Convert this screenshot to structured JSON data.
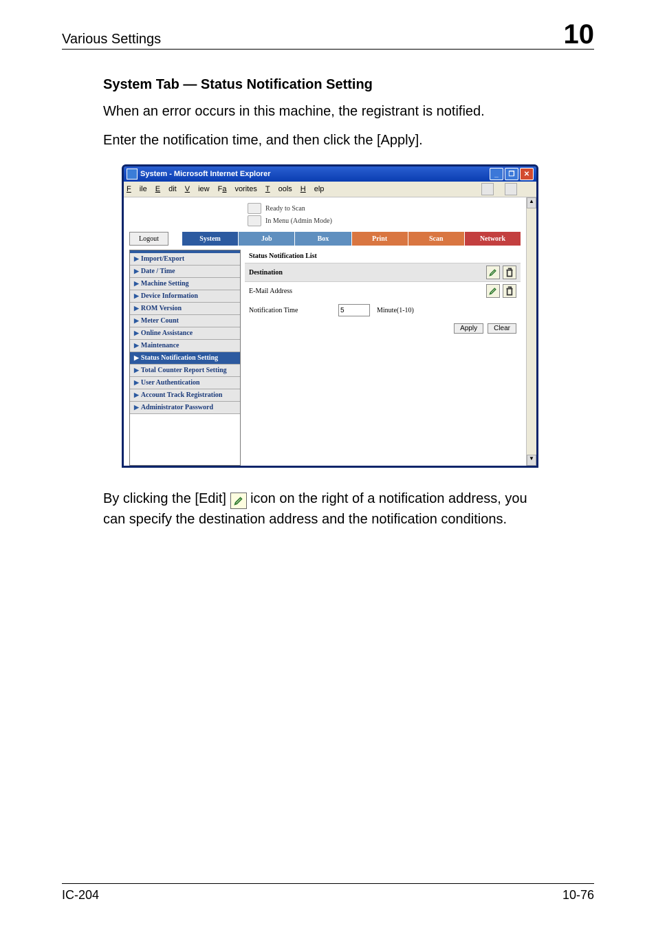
{
  "header": {
    "title": "Various Settings",
    "chapter_number": "10"
  },
  "section": {
    "heading": "System Tab — Status Notification Setting",
    "para1": "When an error occurs in this machine, the registrant is notified.",
    "para2": "Enter the notification time, and then click the [Apply]."
  },
  "window": {
    "title": "System - Microsoft Internet Explorer",
    "menubar": [
      "File",
      "Edit",
      "View",
      "Favorites",
      "Tools",
      "Help"
    ],
    "status": {
      "line1": "Ready to Scan",
      "line2": "In Menu (Admin Mode)"
    },
    "logout_label": "Logout",
    "tabs": {
      "system": "System",
      "job": "Job",
      "box": "Box",
      "print": "Print",
      "scan": "Scan",
      "network": "Network"
    },
    "sidemenu": [
      {
        "label": "Import/Export",
        "active": false
      },
      {
        "label": "Date / Time",
        "active": false
      },
      {
        "label": "Machine Setting",
        "active": false
      },
      {
        "label": "Device Information",
        "active": false
      },
      {
        "label": "ROM Version",
        "active": false
      },
      {
        "label": "Meter Count",
        "active": false
      },
      {
        "label": "Online Assistance",
        "active": false
      },
      {
        "label": "Maintenance",
        "active": false
      },
      {
        "label": "Status Notification Setting",
        "active": true
      },
      {
        "label": "Total Counter Report Setting",
        "active": false
      },
      {
        "label": "User Authentication",
        "active": false
      },
      {
        "label": "Account Track Registration",
        "active": false
      },
      {
        "label": "Administrator Password",
        "active": false
      }
    ],
    "pane": {
      "title": "Status Notification List",
      "rows": [
        {
          "label": "Destination",
          "value": ""
        },
        {
          "label": "E-Mail Address",
          "value": ""
        }
      ],
      "notification_label": "Notification Time",
      "notification_value": "5",
      "notification_unit": "Minute(1-10)",
      "apply_label": "Apply",
      "clear_label": "Clear"
    }
  },
  "footer_para": {
    "pre": "By clicking the [Edit] ",
    "post": " icon on the right of a notification address, you can specify the destination address and the notification conditions."
  },
  "page_footer": {
    "left": "IC-204",
    "right": "10-76"
  }
}
